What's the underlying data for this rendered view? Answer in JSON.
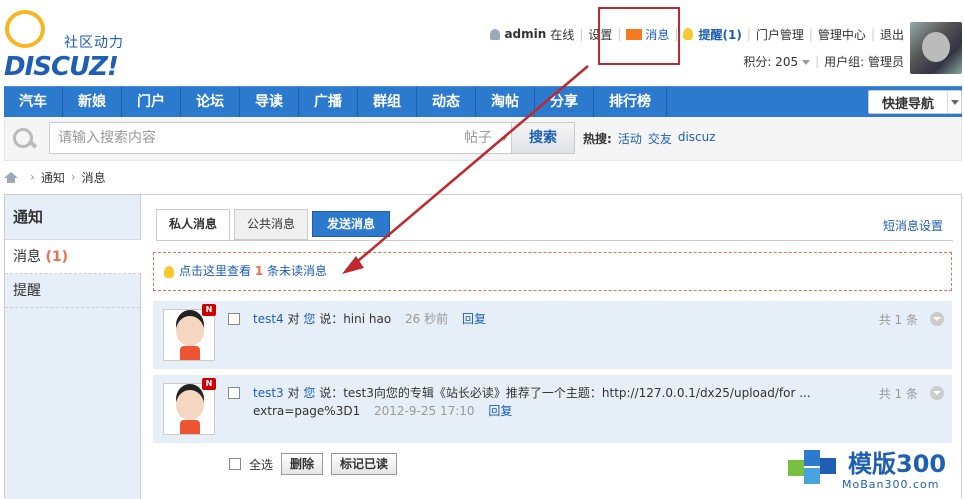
{
  "logo": {
    "cn": "社区动力",
    "en": "DISCUZ!"
  },
  "usermenu": {
    "username": "admin",
    "status": "在线",
    "settings": "设置",
    "messages": "消息",
    "remind": "提醒(1)",
    "portal_admin": "门户管理",
    "admin_center": "管理中心",
    "logout": "退出",
    "credits": "积分: 205",
    "usergroup": "用户组: 管理员"
  },
  "nav": {
    "items": [
      "汽车",
      "新娘",
      "门户",
      "论坛",
      "导读",
      "广播",
      "群组",
      "动态",
      "淘帖",
      "分享",
      "排行榜"
    ],
    "quick": "快捷导航"
  },
  "search": {
    "placeholder": "请输入搜索内容",
    "type": "帖子",
    "button": "搜索",
    "hot_label": "热搜:",
    "hot": [
      "活动",
      "交友",
      "discuz"
    ]
  },
  "breadcrumb": [
    "通知",
    "消息"
  ],
  "sidebar": {
    "title": "通知",
    "items": [
      {
        "label": "消息",
        "count": "(1)"
      },
      {
        "label": "提醒"
      }
    ]
  },
  "tabs": {
    "private": "私人消息",
    "public": "公共消息",
    "send": "发送消息",
    "settings": "短消息设置"
  },
  "notice": {
    "pre": "点击这里查看",
    "count": "1",
    "post": "条未读消息"
  },
  "messages": [
    {
      "user": "test4",
      "to": "对",
      "you": "您",
      "said": "说：hini hao",
      "time": "26 秒前",
      "reply": "回复",
      "total": "共 1 条"
    },
    {
      "user": "test3",
      "to": "对",
      "you": "您",
      "said": "说：test3向您的专辑《站长必读》推荐了一个主题：http://127.0.0.1/dx25/upload/for ...",
      "line2": "extra=page%3D1",
      "time": "2012-9-25 17:10",
      "reply": "回复",
      "total": "共 1 条"
    }
  ],
  "footer": {
    "select_all": "全选",
    "delete": "删除",
    "mark_read": "标记已读"
  },
  "watermark": {
    "title": "模版300",
    "sub": "MoBan300.com"
  },
  "colors": {
    "nav": "#2b7acd",
    "link": "#1e5eb3",
    "accent": "#f26c4f",
    "annotation": "#c0282d"
  }
}
